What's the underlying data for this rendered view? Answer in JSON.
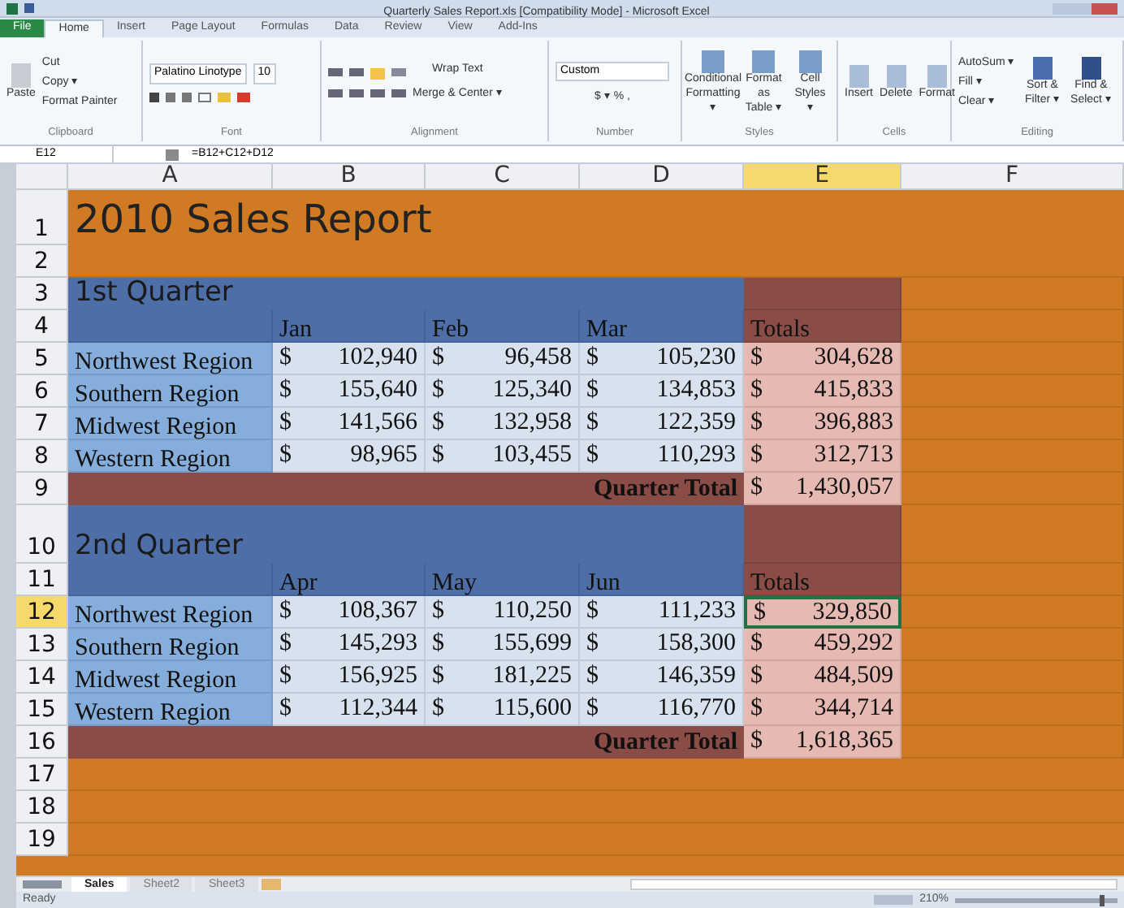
{
  "window": {
    "title": "Quarterly Sales Report.xls [Compatibility Mode] - Microsoft Excel"
  },
  "ribbon_tabs": [
    {
      "label": "File",
      "kind": "file",
      "selected": false
    },
    {
      "label": "Home",
      "kind": "tab",
      "selected": true
    },
    {
      "label": "Insert",
      "kind": "tab",
      "selected": false
    },
    {
      "label": "Page Layout",
      "kind": "tab",
      "selected": false
    },
    {
      "label": "Formulas",
      "kind": "tab",
      "selected": false
    },
    {
      "label": "Data",
      "kind": "tab",
      "selected": false
    },
    {
      "label": "Review",
      "kind": "tab",
      "selected": false
    },
    {
      "label": "View",
      "kind": "tab",
      "selected": false
    },
    {
      "label": "Add-Ins",
      "kind": "tab",
      "selected": false
    }
  ],
  "ribbon": {
    "clipboard": {
      "paste": "Paste",
      "cut": "Cut",
      "copy": "Copy ▾",
      "format_painter": "Format Painter",
      "label": "Clipboard"
    },
    "font": {
      "family": "Palatino Linotype",
      "size": "10",
      "label": "Font"
    },
    "alignment": {
      "wrap": "Wrap Text",
      "merge": "Merge & Center ▾",
      "label": "Alignment"
    },
    "number": {
      "format": "Custom",
      "symbols": "$ ▾ % ,",
      "label": "Number"
    },
    "styles": {
      "buttons": [
        "Conditional Formatting ▾",
        "Format as Table ▾",
        "Cell Styles ▾"
      ],
      "label": "Styles"
    },
    "cells": {
      "buttons": [
        "Insert",
        "Delete",
        "Format"
      ],
      "label": "Cells"
    },
    "editing": {
      "autosum": "AutoSum ▾",
      "fill": "Fill ▾",
      "clear": "Clear ▾",
      "sort": "Sort & Filter ▾",
      "find": "Find & Select ▾",
      "label": "Editing"
    }
  },
  "formula_bar": {
    "name_box": "E12",
    "formula": "=B12+C12+D12"
  },
  "columns": [
    {
      "label": "A",
      "selected": false
    },
    {
      "label": "B",
      "selected": false
    },
    {
      "label": "C",
      "selected": false
    },
    {
      "label": "D",
      "selected": false
    },
    {
      "label": "E",
      "selected": true
    },
    {
      "label": "F",
      "selected": false
    }
  ],
  "rows": [
    {
      "number": "1",
      "kind": "title",
      "selected": false,
      "text": "2010 Sales Report"
    },
    {
      "number": "2",
      "kind": "blank",
      "selected": false
    },
    {
      "number": "3",
      "kind": "section",
      "selected": false,
      "text": "1st Quarter"
    },
    {
      "number": "4",
      "kind": "header",
      "selected": false,
      "months": [
        "Jan",
        "Feb",
        "Mar"
      ],
      "total": "Totals"
    },
    {
      "number": "5",
      "kind": "data",
      "selected": false,
      "label": "Northwest Region",
      "values": [
        {
          "currency": "$",
          "amount": "102,940"
        },
        {
          "currency": "$",
          "amount": "96,458"
        },
        {
          "currency": "$",
          "amount": "105,230"
        }
      ],
      "total": {
        "currency": "$",
        "amount": "304,628",
        "selected": false
      }
    },
    {
      "number": "6",
      "kind": "data",
      "selected": false,
      "label": "Southern Region",
      "values": [
        {
          "currency": "$",
          "amount": "155,640"
        },
        {
          "currency": "$",
          "amount": "125,340"
        },
        {
          "currency": "$",
          "amount": "134,853"
        }
      ],
      "total": {
        "currency": "$",
        "amount": "415,833",
        "selected": false
      }
    },
    {
      "number": "7",
      "kind": "data",
      "selected": false,
      "label": "Midwest Region",
      "values": [
        {
          "currency": "$",
          "amount": "141,566"
        },
        {
          "currency": "$",
          "amount": "132,958"
        },
        {
          "currency": "$",
          "amount": "122,359"
        }
      ],
      "total": {
        "currency": "$",
        "amount": "396,883",
        "selected": false
      }
    },
    {
      "number": "8",
      "kind": "data",
      "selected": false,
      "label": "Western Region",
      "values": [
        {
          "currency": "$",
          "amount": "98,965"
        },
        {
          "currency": "$",
          "amount": "103,455"
        },
        {
          "currency": "$",
          "amount": "110,293"
        }
      ],
      "total": {
        "currency": "$",
        "amount": "312,713",
        "selected": false
      }
    },
    {
      "number": "9",
      "kind": "total",
      "selected": false,
      "label": "Quarter Total",
      "total": {
        "currency": "$",
        "amount": "1,430,057"
      }
    },
    {
      "number": "10",
      "kind": "section",
      "selected": false,
      "text": "2nd Quarter"
    },
    {
      "number": "11",
      "kind": "header",
      "selected": false,
      "months": [
        "Apr",
        "May",
        "Jun"
      ],
      "total": "Totals"
    },
    {
      "number": "12",
      "kind": "data",
      "selected": true,
      "label": "Northwest Region",
      "values": [
        {
          "currency": "$",
          "amount": "108,367"
        },
        {
          "currency": "$",
          "amount": "110,250"
        },
        {
          "currency": "$",
          "amount": "111,233"
        }
      ],
      "total": {
        "currency": "$",
        "amount": "329,850",
        "selected": true
      }
    },
    {
      "number": "13",
      "kind": "data",
      "selected": false,
      "label": "Southern Region",
      "values": [
        {
          "currency": "$",
          "amount": "145,293"
        },
        {
          "currency": "$",
          "amount": "155,699"
        },
        {
          "currency": "$",
          "amount": "158,300"
        }
      ],
      "total": {
        "currency": "$",
        "amount": "459,292",
        "selected": false
      }
    },
    {
      "number": "14",
      "kind": "data",
      "selected": false,
      "label": "Midwest Region",
      "values": [
        {
          "currency": "$",
          "amount": "156,925"
        },
        {
          "currency": "$",
          "amount": "181,225"
        },
        {
          "currency": "$",
          "amount": "146,359"
        }
      ],
      "total": {
        "currency": "$",
        "amount": "484,509",
        "selected": false
      }
    },
    {
      "number": "15",
      "kind": "data",
      "selected": false,
      "label": "Western Region",
      "values": [
        {
          "currency": "$",
          "amount": "112,344"
        },
        {
          "currency": "$",
          "amount": "115,600"
        },
        {
          "currency": "$",
          "amount": "116,770"
        }
      ],
      "total": {
        "currency": "$",
        "amount": "344,714",
        "selected": false
      }
    },
    {
      "number": "16",
      "kind": "total",
      "selected": false,
      "label": "Quarter Total",
      "total": {
        "currency": "$",
        "amount": "1,618,365"
      }
    },
    {
      "number": "17",
      "kind": "blank",
      "selected": false
    },
    {
      "number": "18",
      "kind": "blank",
      "selected": false
    },
    {
      "number": "19",
      "kind": "blank",
      "selected": false
    }
  ],
  "sheet_tabs": [
    {
      "label": "Sales",
      "selected": true
    },
    {
      "label": "Sheet2",
      "selected": false
    },
    {
      "label": "Sheet3",
      "selected": false
    }
  ],
  "status_bar": {
    "status": "Ready",
    "zoom": "210%",
    "zoom_slider": {
      "level": 0.92
    }
  }
}
